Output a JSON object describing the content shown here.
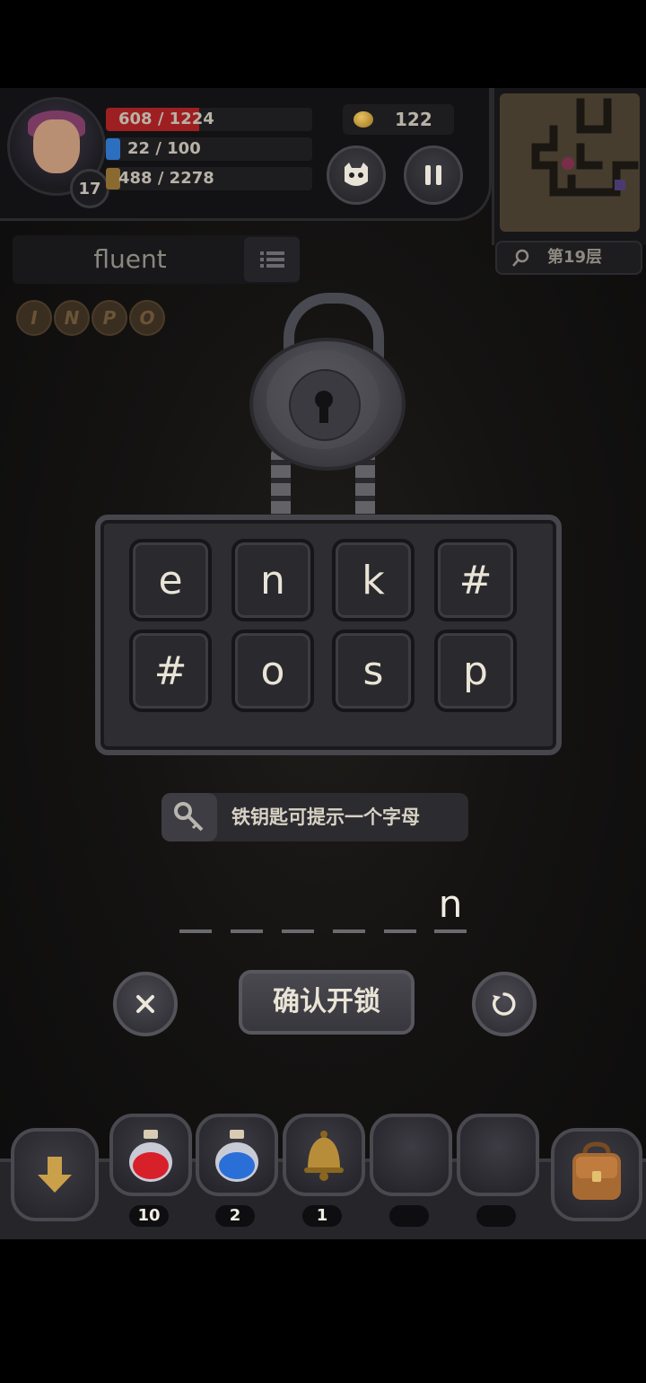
{
  "hud": {
    "hp": "608 / 1224",
    "mp": "22 / 100",
    "xp": "488 / 2278",
    "level": "17",
    "gold": "122",
    "floor": "第19层",
    "colors": {
      "hp": "#c0282a",
      "mp": "#2d6fbf",
      "xp": "#b58a3a",
      "gold": "#d8a838"
    }
  },
  "word": "fluent",
  "runes": [
    "I",
    "N",
    "P",
    "O"
  ],
  "letters": [
    [
      "e",
      "n",
      "k",
      "#"
    ],
    [
      "#",
      "o",
      "s",
      "p"
    ]
  ],
  "hint": "铁钥匙可提示一个字母",
  "answer": [
    "",
    "",
    "",
    "",
    "",
    "n"
  ],
  "confirm_label": "确认开锁",
  "items": [
    {
      "icon": "red-potion-icon",
      "count": "10"
    },
    {
      "icon": "blue-potion-icon",
      "count": "2"
    },
    {
      "icon": "bell-icon",
      "count": "1"
    },
    {
      "icon": "empty-slot",
      "count": ""
    },
    {
      "icon": "empty-slot",
      "count": ""
    }
  ]
}
